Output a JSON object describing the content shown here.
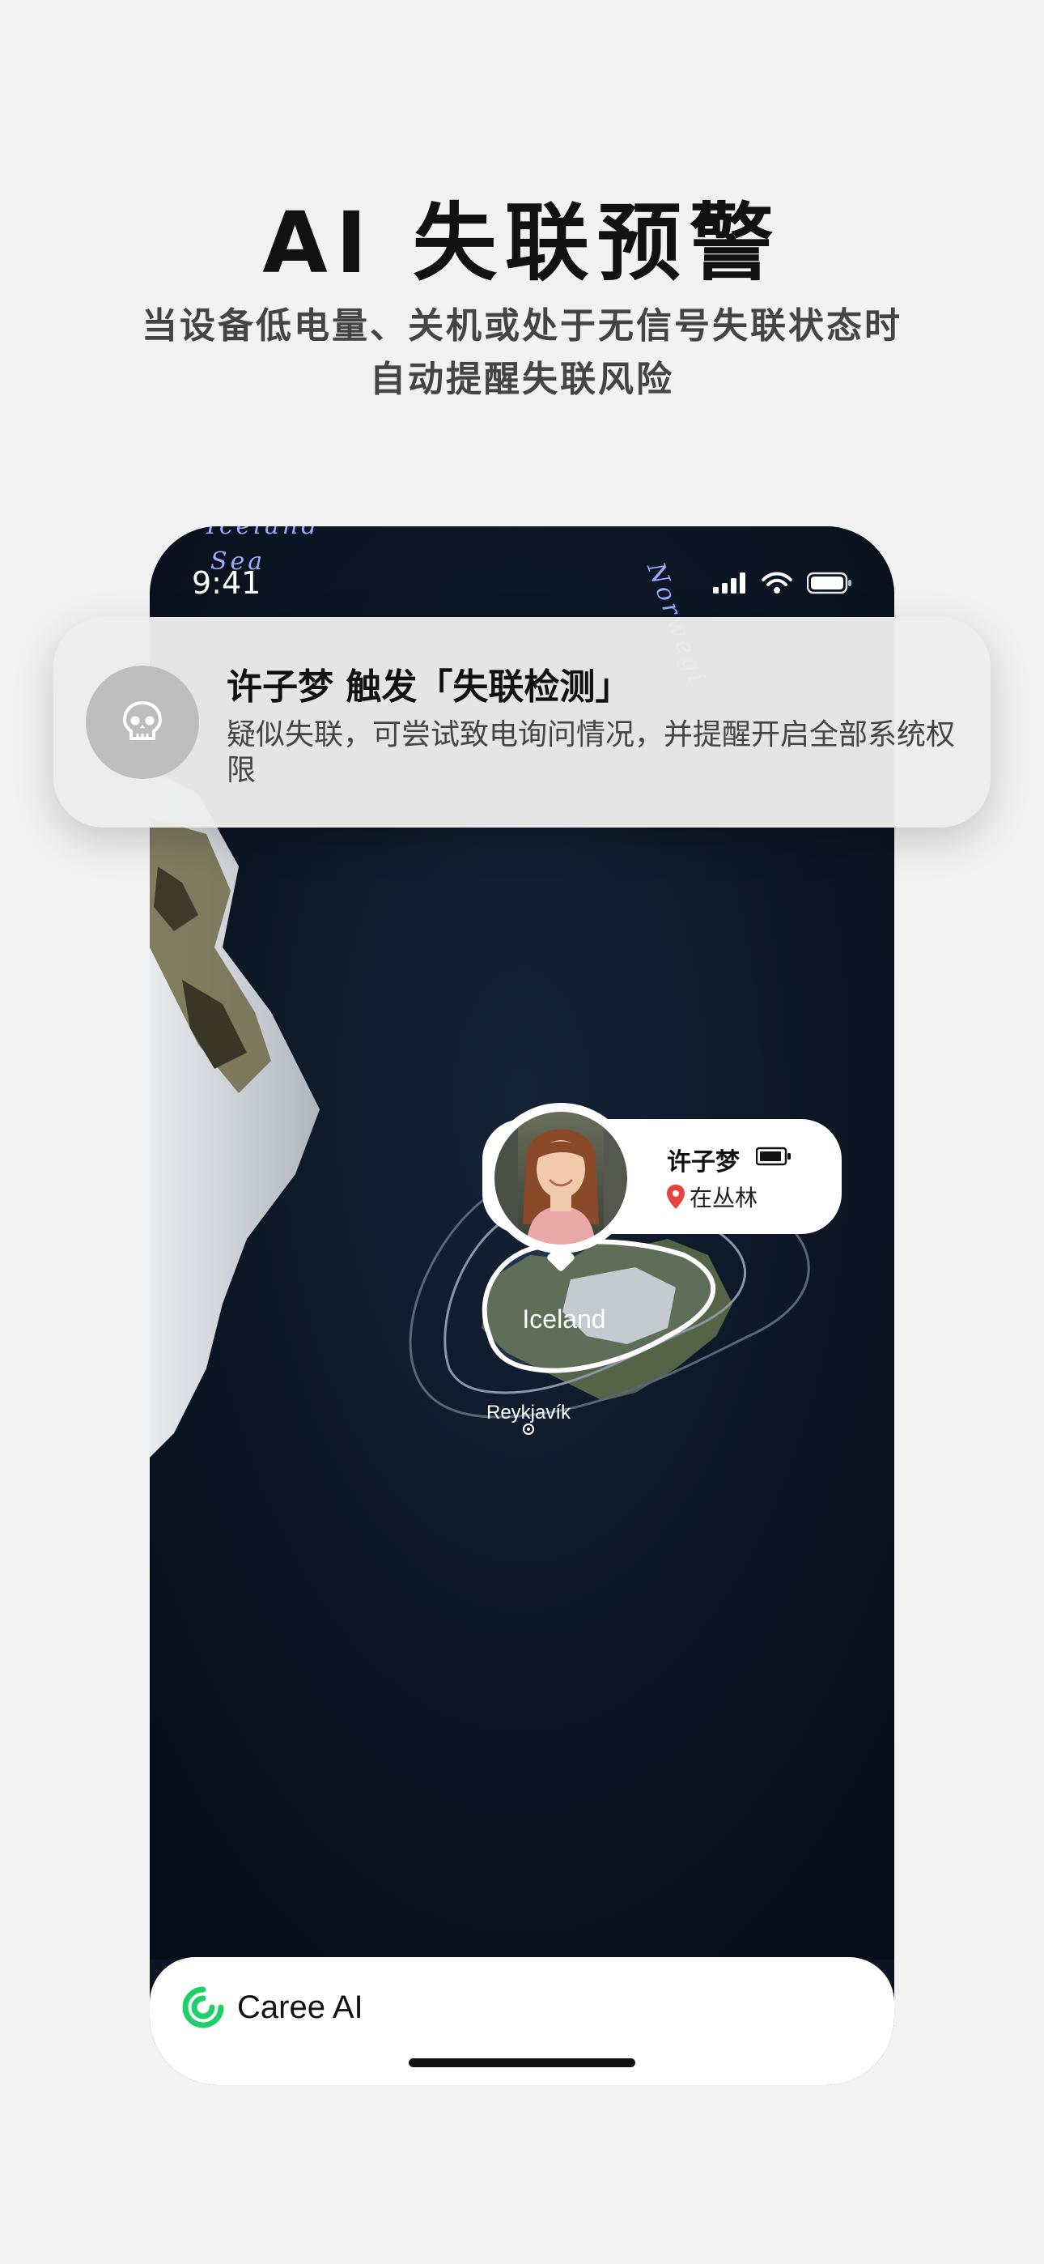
{
  "header": {
    "title": "AI 失联预警",
    "subtitle_line1": "当设备低电量、关机或处于无信号失联状态时",
    "subtitle_line2": "自动提醒失联风险"
  },
  "phone": {
    "status_bar": {
      "time": "9:41"
    },
    "map": {
      "sea_label_1": "Iceland",
      "sea_label_2": "Sea",
      "sea_label_3": "Norwegi",
      "country_label": "Iceland",
      "city_label": "Reykjavík"
    },
    "person": {
      "name": "许子梦",
      "status": "在丛林"
    },
    "bottom_bar": {
      "brand": "Caree AI"
    }
  },
  "notification": {
    "title": "许子梦 触发「失联检测」",
    "body": "疑似失联，可尝试致电询问情况，并提醒开启全部系统权限",
    "icon": "skull-icon"
  },
  "colors": {
    "background": "#f2f2f2",
    "map_ocean": "#0b1524",
    "brand_green": "#1fcf6a"
  }
}
